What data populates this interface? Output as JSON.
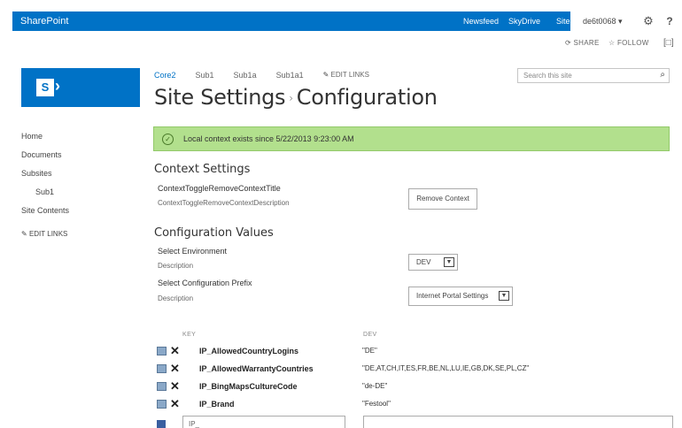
{
  "suite": {
    "brand": "SharePoint",
    "links": [
      "Newsfeed",
      "SkyDrive"
    ],
    "sites": "Sites",
    "user": "de6t0068 ▾",
    "gear": "⚙",
    "help": "?"
  },
  "ribbon": {
    "share": "SHARE",
    "follow": "FOLLOW",
    "focus": "[□]"
  },
  "logo": {
    "letter": "S",
    "glyph": "›"
  },
  "topnav": {
    "current": "Core2",
    "items": [
      "Sub1",
      "Sub1a",
      "Sub1a1"
    ],
    "edit": "EDIT LINKS"
  },
  "search": {
    "placeholder": "Search this site",
    "icon": "⌕"
  },
  "title": {
    "part1": "Site Settings",
    "sep": "›",
    "part2": "Configuration"
  },
  "leftnav": {
    "items": [
      "Home",
      "Documents",
      "Subsites",
      "Sub1",
      "Site Contents"
    ],
    "edit": "EDIT LINKS"
  },
  "banner": {
    "icon": "✓",
    "message": "Local context exists since 5/22/2013 9:23:00 AM"
  },
  "context": {
    "heading": "Context Settings",
    "title": "ContextToggleRemoveContextTitle",
    "description": "ContextToggleRemoveContextDescription",
    "button": "Remove Context"
  },
  "config": {
    "heading": "Configuration Values",
    "env_label": "Select Environment",
    "env_desc": "Description",
    "env_value": "DEV",
    "prefix_label": "Select Configuration Prefix",
    "prefix_desc": "Description",
    "prefix_value": "Internet Portal Settings"
  },
  "table": {
    "col_key": "KEY",
    "col_val": "DEV",
    "rows": [
      {
        "key": "IP_AllowedCountryLogins",
        "value": "\"DE\""
      },
      {
        "key": "IP_AllowedWarrantyCountries",
        "value": "\"DE,AT,CH,IT,ES,FR,BE,NL,LU,IE,GB,DK,SE,PL,CZ\""
      },
      {
        "key": "IP_BingMapsCultureCode",
        "value": "\"de-DE\""
      },
      {
        "key": "IP_Brand",
        "value": "\"Festool\""
      }
    ],
    "new_key_placeholder": "IP_"
  },
  "colors": {
    "suite": "#0072c6",
    "banner": "#b2e08d",
    "accent": "#0072c6"
  }
}
